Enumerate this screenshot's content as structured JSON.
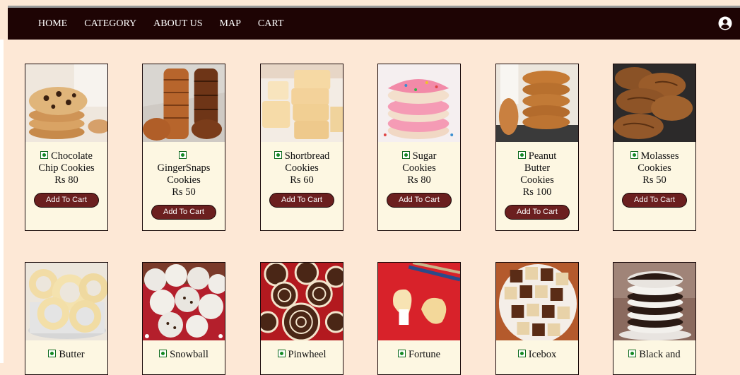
{
  "nav": {
    "home": "HOME",
    "category": "CATEGORY",
    "about": "ABOUT US",
    "map": "MAP",
    "cart": "CART"
  },
  "products": [
    {
      "name1": "Chocolate",
      "name2": "Chip Cookies",
      "price": "Rs 80",
      "button": "Add To Cart"
    },
    {
      "name1": "",
      "name2": "GingerSnaps",
      "name3": "Cookies",
      "price": "Rs 50",
      "button": "Add To Cart"
    },
    {
      "name1": "Shortbread",
      "name2": "Cookies",
      "price": "Rs 60",
      "button": "Add To Cart"
    },
    {
      "name1": "Sugar",
      "name2": "Cookies",
      "price": "Rs 80",
      "button": "Add To Cart"
    },
    {
      "name1": "Peanut",
      "name2": "Butter",
      "name3": "Cookies",
      "price": "Rs 100",
      "button": "Add To Cart"
    },
    {
      "name1": "Molasses",
      "name2": "Cookies",
      "price": "Rs 50",
      "button": "Add To Cart"
    },
    {
      "name1": "Butter"
    },
    {
      "name1": "Snowball"
    },
    {
      "name1": "Pinwheel"
    },
    {
      "name1": "Fortune"
    },
    {
      "name1": "Icebox"
    },
    {
      "name1": "Black and"
    }
  ],
  "icons": {
    "user": "user-circle-icon",
    "veg": "veg-indicator-icon"
  },
  "colors": {
    "navbar": "#1e0404",
    "background": "#fde8d6",
    "card": "#fdf7e2",
    "button": "#6b1f1f",
    "veg": "#138a24"
  }
}
